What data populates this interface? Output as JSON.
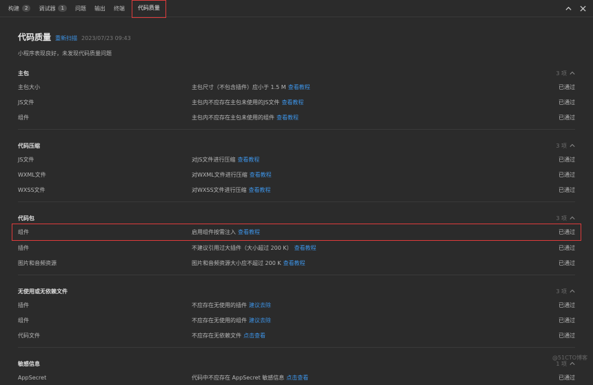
{
  "tabs": [
    {
      "label": "构建",
      "badge": "2"
    },
    {
      "label": "调试器",
      "badge": "1"
    },
    {
      "label": "问题",
      "badge": ""
    },
    {
      "label": "输出",
      "badge": ""
    },
    {
      "label": "终端",
      "badge": ""
    },
    {
      "label": "代码质量",
      "badge": "",
      "active": true
    }
  ],
  "page": {
    "title": "代码质量",
    "rescan": "重新扫描",
    "timestamp": "2023/07/23 09:43",
    "summary": "小程序表现良好，未发现代码质量问题"
  },
  "sections": [
    {
      "title": "主包",
      "count": "3 项",
      "rows": [
        {
          "name": "主包大小",
          "desc": "主包尺寸（不包含插件）应小于 1.5 M",
          "link": "查看教程",
          "status": "已通过"
        },
        {
          "name": "JS文件",
          "desc": "主包内不应存在主包未使用的JS文件",
          "link": "查看教程",
          "status": "已通过"
        },
        {
          "name": "组件",
          "desc": "主包内不应存在主包未使用的组件",
          "link": "查看教程",
          "status": "已通过"
        }
      ]
    },
    {
      "title": "代码压缩",
      "count": "3 项",
      "rows": [
        {
          "name": "JS文件",
          "desc": "对JS文件进行压缩",
          "link": "查看教程",
          "status": "已通过"
        },
        {
          "name": "WXML文件",
          "desc": "对WXML文件进行压缩",
          "link": "查看教程",
          "status": "已通过"
        },
        {
          "name": "WXSS文件",
          "desc": "对WXSS文件进行压缩",
          "link": "查看教程",
          "status": "已通过"
        }
      ]
    },
    {
      "title": "代码包",
      "count": "3 项",
      "rows": [
        {
          "name": "组件",
          "desc": "启用组件按需注入",
          "link": "查看教程",
          "status": "已通过",
          "highlight": true
        },
        {
          "name": "插件",
          "desc": "不建议引用过大插件（大小超过 200 K）",
          "link": "查看教程",
          "status": "已通过"
        },
        {
          "name": "图片和音频资源",
          "desc": "图片和音频资源大小应不超过 200 K",
          "link": "查看教程",
          "status": "已通过"
        }
      ]
    },
    {
      "title": "无使用或无依赖文件",
      "count": "3 项",
      "rows": [
        {
          "name": "插件",
          "desc": "不应存在无使用的插件",
          "link": "建议去除",
          "status": "已通过"
        },
        {
          "name": "组件",
          "desc": "不应存在无使用的组件",
          "link": "建议去除",
          "status": "已通过"
        },
        {
          "name": "代码文件",
          "desc": "不应存在无依赖文件",
          "link": "点击查看",
          "status": "已通过"
        }
      ]
    },
    {
      "title": "敏感信息",
      "count": "1 项",
      "rows": [
        {
          "name": "AppSecret",
          "desc": "代码中不应存在 AppSecret 敏感信息",
          "link": "点击查看",
          "status": "已通过"
        }
      ]
    }
  ],
  "watermark": "@51CTO博客",
  "colors": {
    "accent": "#3d93e6",
    "highlight": "#e03b3b",
    "background": "#2b2b2b"
  }
}
